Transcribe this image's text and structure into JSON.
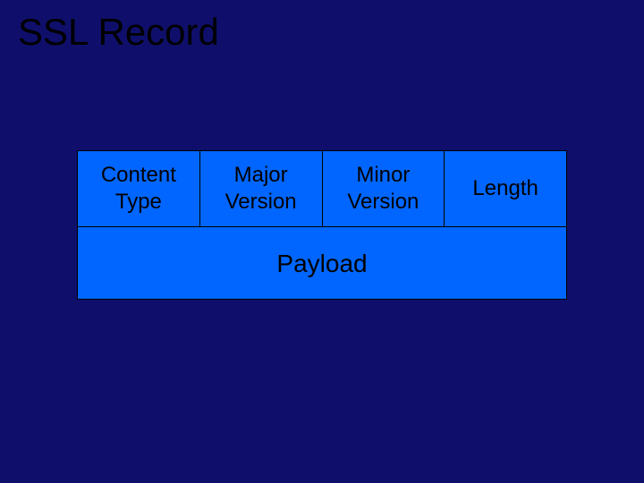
{
  "title": "SSL Record",
  "header": {
    "content_type": "Content\nType",
    "major_version": "Major\nVersion",
    "minor_version": "Minor\nVersion",
    "length": "Length"
  },
  "payload_label": "Payload"
}
